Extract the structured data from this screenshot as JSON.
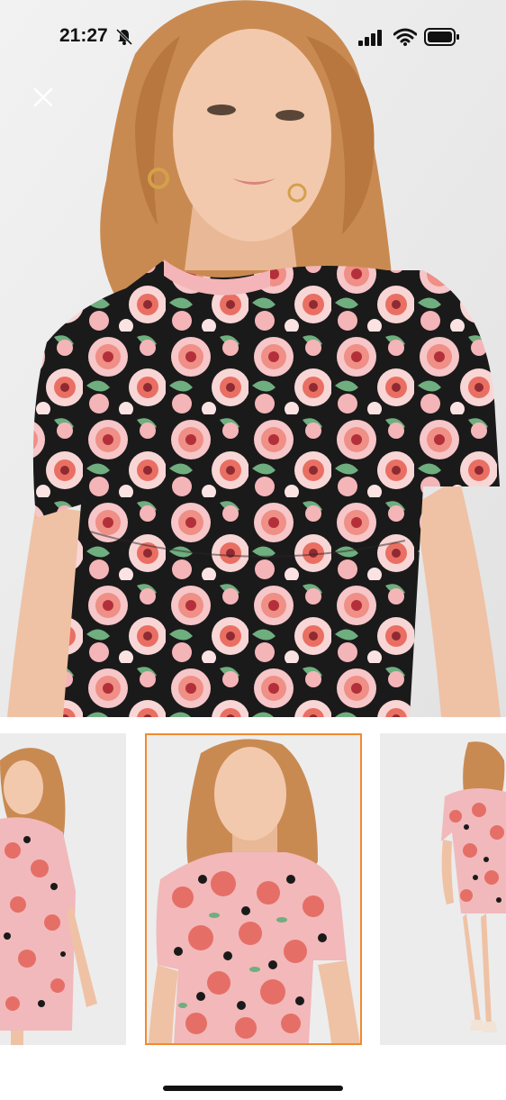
{
  "status_bar": {
    "time": "21:27",
    "icons": [
      "bell-slash-icon",
      "cellular-signal-icon",
      "wifi-icon",
      "battery-icon"
    ]
  },
  "viewer": {
    "close_icon": "close-icon",
    "main_image": "model-wearing-pink-floral-puff-sleeve-dress-closeup",
    "thumbnails": [
      {
        "image": "model-floral-dress-front-three-quarter",
        "selected": false
      },
      {
        "image": "model-floral-dress-upper-body-closeup",
        "selected": true
      },
      {
        "image": "model-floral-dress-back-view",
        "selected": false
      }
    ],
    "selected_border_color": "#f28a2e"
  },
  "colors": {
    "background": "#ffffff",
    "photo_backdrop": "#ececec",
    "dress_pink": "#f4b5b8",
    "dress_coral": "#ea6f63",
    "dress_black": "#1b1a1a",
    "leaf_green": "#6fae7f",
    "hair": "#c98a52",
    "skin": "#f2c9ad"
  }
}
